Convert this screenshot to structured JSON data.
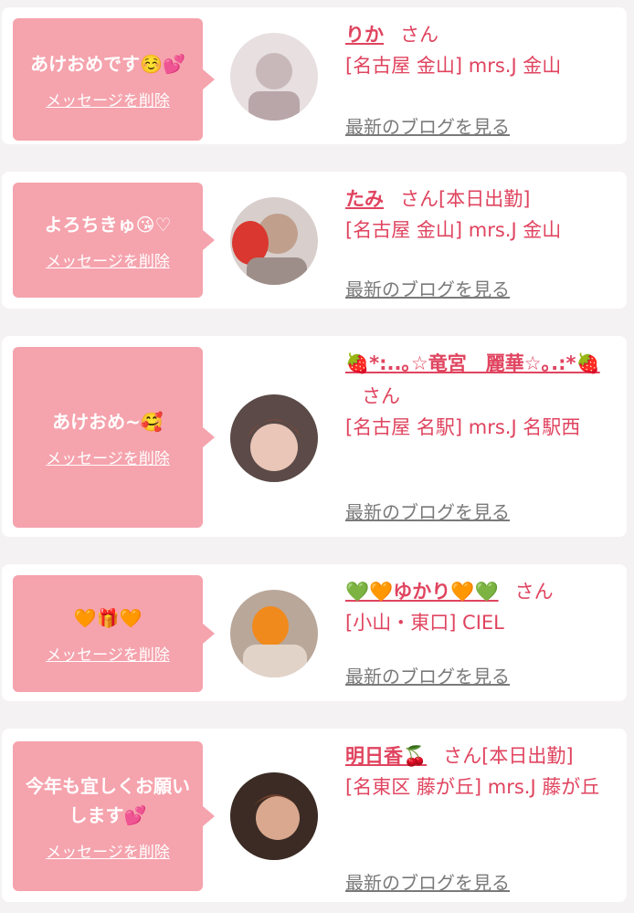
{
  "messages": [
    {
      "text": "あけおめです☺️💕",
      "delete_label": "メッセージを削除",
      "name": "りか",
      "suffix": "さん",
      "shop": "[名古屋 金山] mrs.J 金山",
      "blog_label": "最新のブログを見る"
    },
    {
      "text": "よろちきゅ😘♡",
      "delete_label": "メッセージを削除",
      "name": "たみ",
      "suffix": "さん[本日出勤]",
      "shop": "[名古屋 金山] mrs.J 金山",
      "blog_label": "最新のブログを見る"
    },
    {
      "text": "あけおめ~🥰",
      "delete_label": "メッセージを削除",
      "name": "🍓*:..｡☆竜宮　麗華☆｡.:*🍓",
      "suffix": "さん",
      "shop": "[名古屋 名駅] mrs.J 名駅西",
      "blog_label": "最新のブログを見る"
    },
    {
      "text": "🧡🎁🧡",
      "delete_label": "メッセージを削除",
      "name": "💚🧡ゆかり🧡💚",
      "suffix": "さん",
      "shop": "[小山・東口] CIEL",
      "blog_label": "最新のブログを見る"
    },
    {
      "text": "今年も宜しくお願いします💕",
      "delete_label": "メッセージを削除",
      "name": "明日香🍒",
      "suffix": "さん[本日出勤]",
      "shop": "[名東区 藤が丘] mrs.J 藤が丘",
      "blog_label": "最新のブログを見る"
    }
  ],
  "colors": {
    "accent": "#e0445f",
    "bubble": "#f5a3ad",
    "link_gray": "#7a7a7a",
    "background": "#f4f2f3"
  }
}
